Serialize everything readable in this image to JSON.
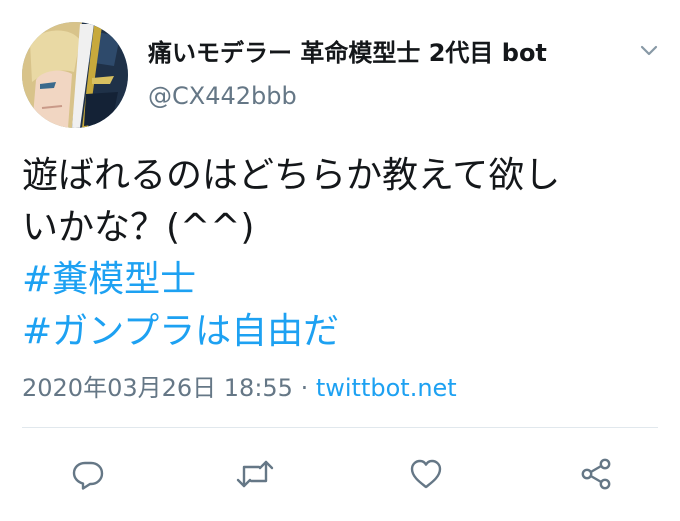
{
  "user": {
    "display_name": "痛いモデラー 革命模型士 2代目 bot",
    "handle": "@CX442bbb"
  },
  "tweet": {
    "lines": [
      "遊ばれるのはどちらか教えて欲し",
      "いかな？(^^)"
    ],
    "hashtags": [
      "#糞模型士",
      "#ガンプラは自由だ"
    ],
    "timestamp": "2020年03月26日 18:55",
    "separator": " · ",
    "source": "twittbot.net"
  },
  "icons": {
    "caret": "chevron-down-icon",
    "reply": "reply-icon",
    "retweet": "retweet-icon",
    "like": "heart-icon",
    "share": "share-icon"
  },
  "colors": {
    "text": "#14171a",
    "secondary": "#657786",
    "link": "#1da1f2",
    "divider": "#e1e8ed"
  }
}
